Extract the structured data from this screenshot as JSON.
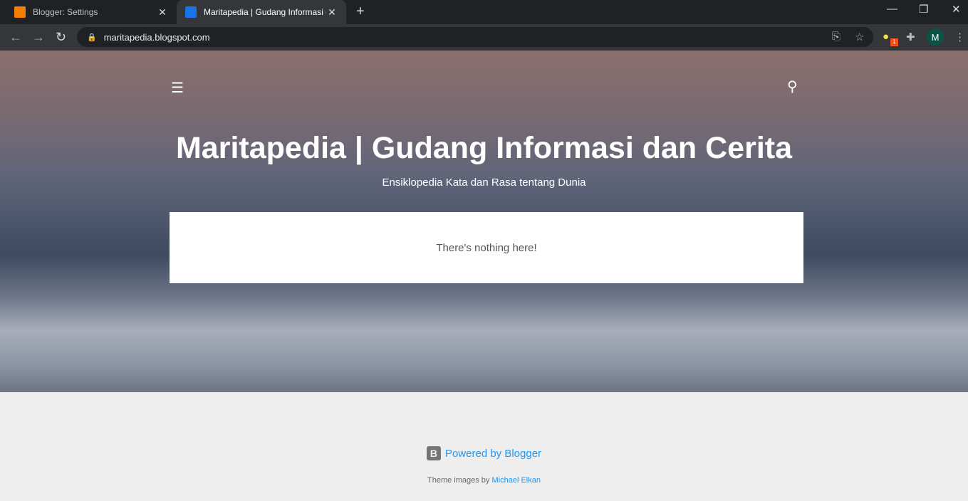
{
  "browser": {
    "tabs": [
      {
        "title": "Blogger: Settings",
        "favicon_color": "#f57d00"
      },
      {
        "title": "Maritapedia | Gudang Informasi dan Cerita",
        "favicon_color": "#1a73e8",
        "active": true
      }
    ],
    "url": "maritapedia.blogspot.com",
    "extension_badge": "1",
    "profile_initial": "M"
  },
  "blog": {
    "title": "Maritapedia | Gudang Informasi dan Cerita",
    "subtitle": "Ensiklopedia Kata dan Rasa tentang Dunia",
    "empty_message": "There's nothing here!"
  },
  "footer": {
    "powered_by": "Powered by Blogger",
    "theme_credit_prefix": "Theme images by",
    "theme_credit_author": "Michael Elkan"
  }
}
